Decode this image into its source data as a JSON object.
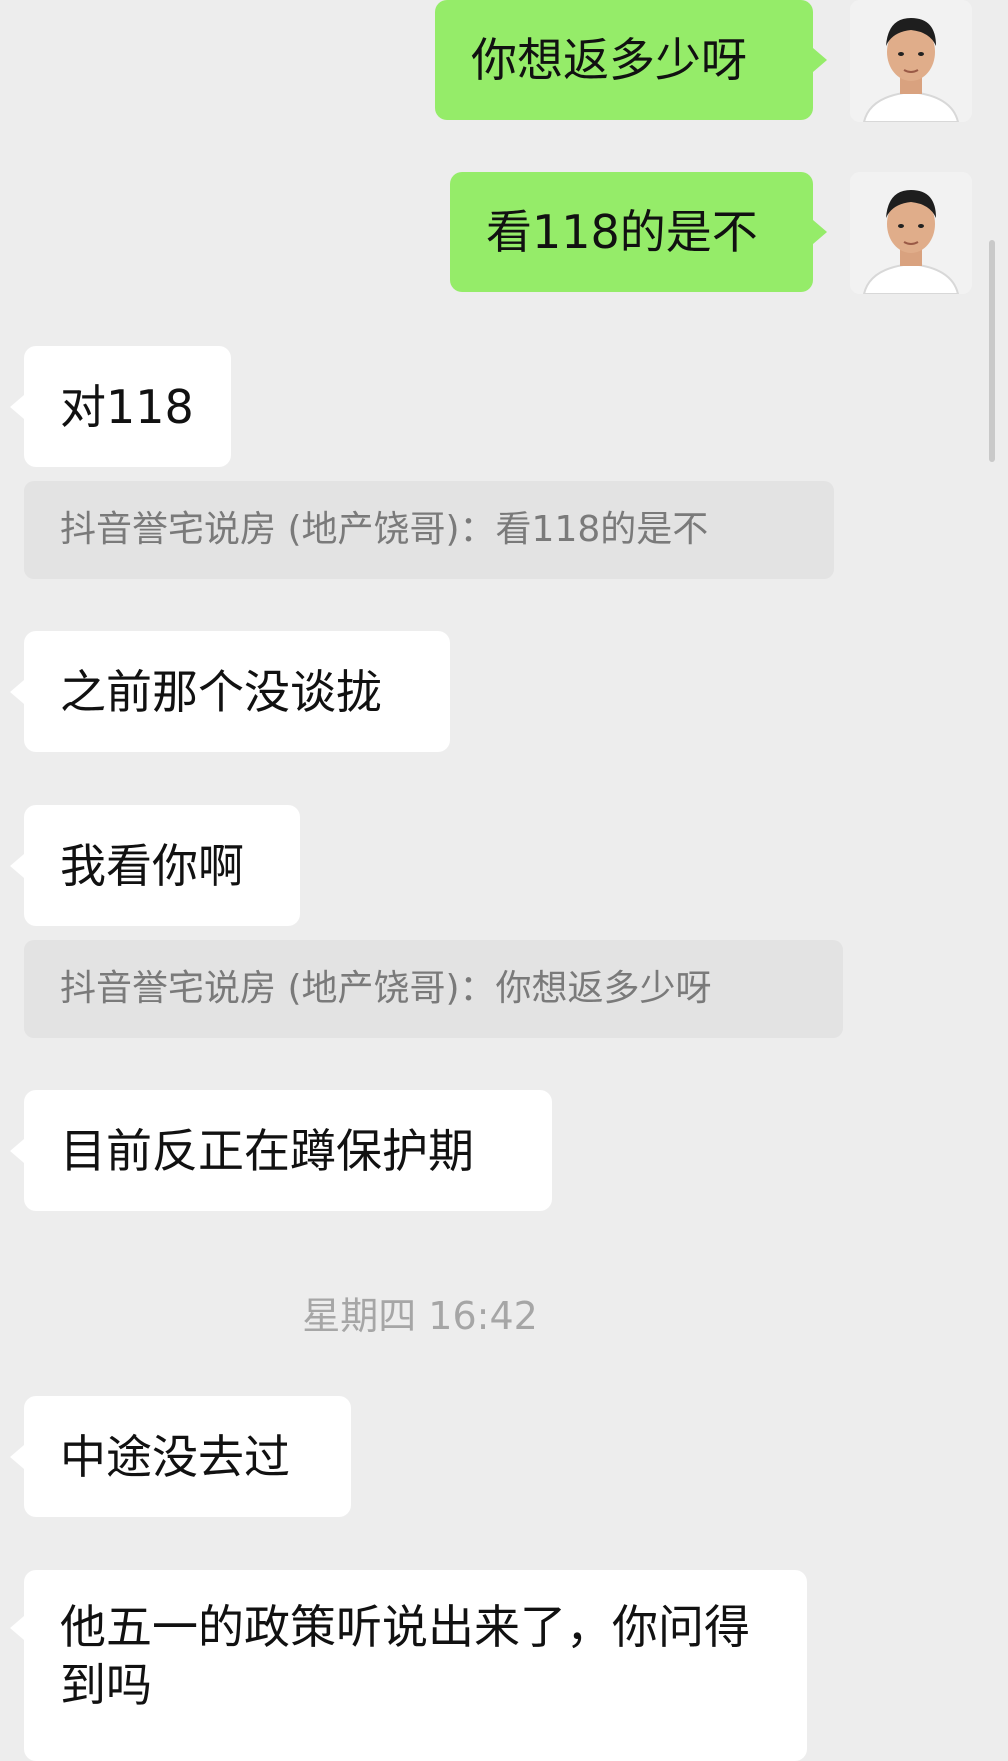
{
  "messages": {
    "m1": "你想返多少呀",
    "m2": "看118的是不",
    "m3": "对118",
    "q1": "抖音誉宅说房 (地产饶哥)：看118的是不",
    "m4": "之前那个没谈拢",
    "m5": "我看你啊",
    "q2": "抖音誉宅说房 (地产饶哥)：你想返多少呀",
    "m6": "目前反正在蹲保护期",
    "timestamp": "星期四 16:42",
    "m7": "中途没去过",
    "m8": "他五一的政策听说出来了，你问得到吗"
  },
  "colors": {
    "background": "#ededed",
    "outgoing_bubble": "#95ec69",
    "incoming_bubble": "#ffffff",
    "quote_bg": "#e3e3e3"
  },
  "icons": {
    "avatar": "user-avatar-photo"
  }
}
